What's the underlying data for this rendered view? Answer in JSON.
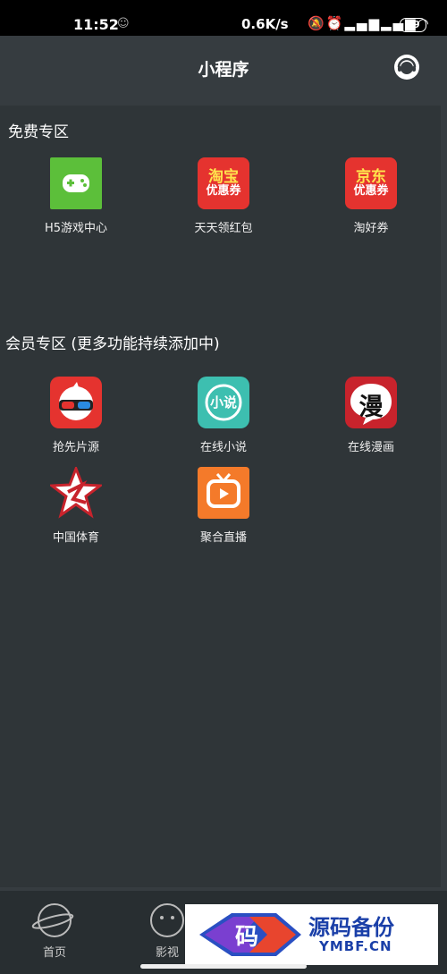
{
  "status_bar": {
    "time": "11:52",
    "net_speed": "0.6K/s",
    "battery": "89"
  },
  "header": {
    "title": "小程序"
  },
  "free_section": {
    "title": "免费专区",
    "items": [
      {
        "label": "H5游戏中心",
        "icon": "gamepad-icon"
      },
      {
        "label": "天天领红包",
        "icon": "taobao-coupon-icon",
        "icon_text_1": "淘宝",
        "icon_text_2": "优惠券"
      },
      {
        "label": "淘好券",
        "icon": "jd-coupon-icon",
        "icon_text_1": "京东",
        "icon_text_2": "优惠券"
      }
    ]
  },
  "vip_section": {
    "title": "会员专区 (更多功能持续添加中)",
    "items": [
      {
        "label": "抢先片源",
        "icon": "3d-glasses-icon"
      },
      {
        "label": "在线小说",
        "icon": "novel-icon",
        "icon_text": "小说"
      },
      {
        "label": "在线漫画",
        "icon": "comic-icon",
        "icon_text": "漫"
      },
      {
        "label": "中国体育",
        "icon": "china-sports-icon"
      },
      {
        "label": "聚合直播",
        "icon": "live-tv-icon"
      }
    ]
  },
  "bottom_nav": {
    "items": [
      {
        "label": "首页",
        "icon": "planet-icon"
      },
      {
        "label": "影视",
        "icon": "face-icon"
      }
    ]
  },
  "watermark": {
    "logo_text": "码",
    "name": "源码备份",
    "url": "YMBF.CN"
  },
  "colors": {
    "background": "#363c40",
    "panel": "#2f3538",
    "accent_red": "#e5332f",
    "green": "#5cbf3a"
  }
}
